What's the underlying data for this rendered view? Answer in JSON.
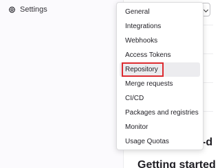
{
  "sidebar": {
    "settings_label": "Settings"
  },
  "main": {
    "partial_heading": "-d",
    "getting_started": "Getting started"
  },
  "dropdown": {
    "items": [
      {
        "label": "General"
      },
      {
        "label": "Integrations"
      },
      {
        "label": "Webhooks"
      },
      {
        "label": "Access Tokens"
      },
      {
        "label": "Repository"
      },
      {
        "label": "Merge requests"
      },
      {
        "label": "CI/CD"
      },
      {
        "label": "Packages and registries"
      },
      {
        "label": "Monitor"
      },
      {
        "label": "Usage Quotas"
      }
    ],
    "selected": "Repository"
  },
  "colors": {
    "highlight_box": "#dd2b30",
    "active_item_bg": "#ececef",
    "sidebar_bg": "#fbfafd"
  }
}
